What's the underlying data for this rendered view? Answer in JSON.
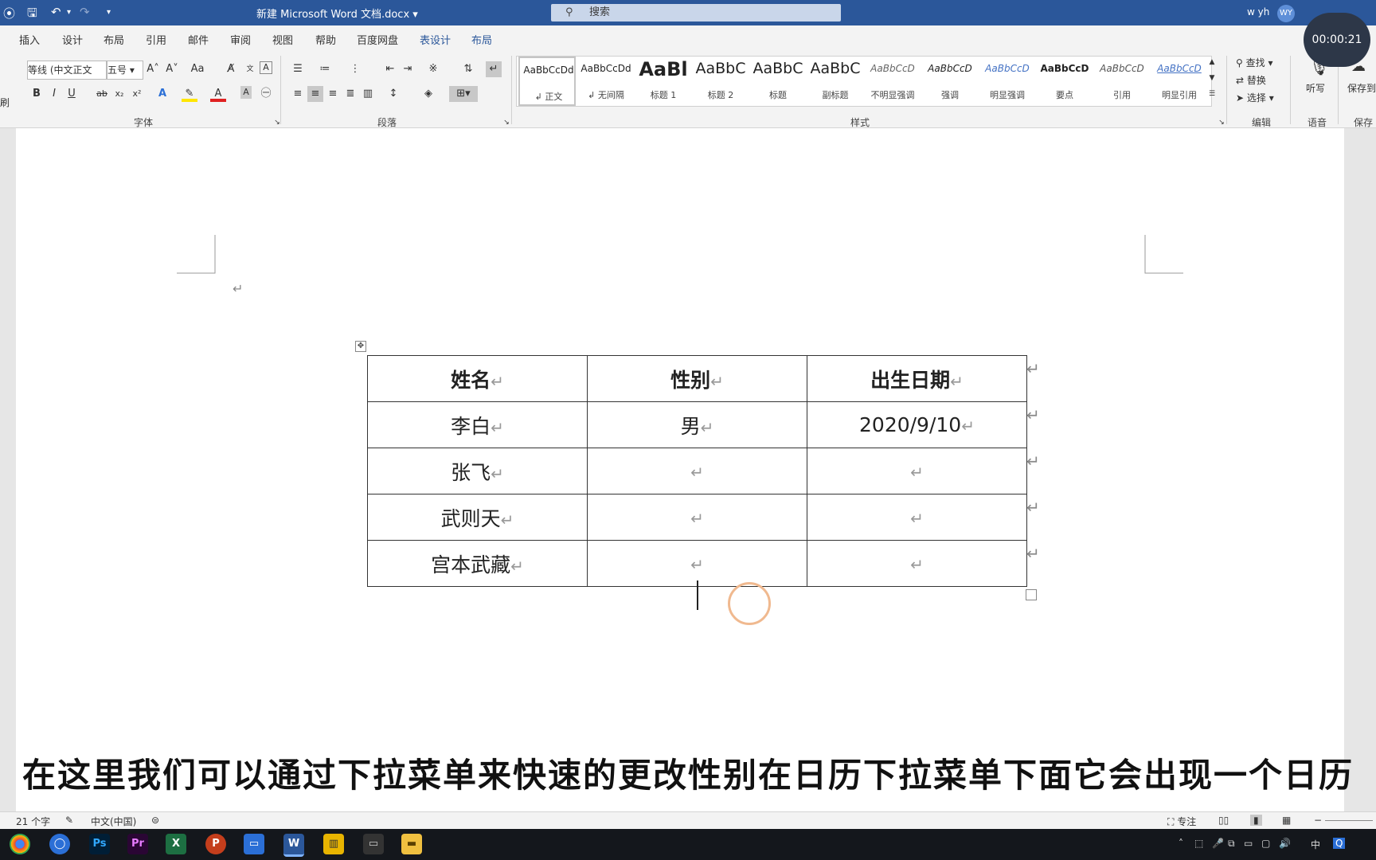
{
  "titlebar": {
    "doc_title": "新建 Microsoft Word 文档.docx",
    "search_placeholder": "搜索",
    "user_name": "w yh",
    "avatar_initials": "WY"
  },
  "ribbon_tabs": [
    "插入",
    "设计",
    "布局",
    "引用",
    "邮件",
    "审阅",
    "视图",
    "帮助",
    "百度网盘",
    "表设计",
    "布局"
  ],
  "font_group": {
    "font_name": "等线 (中文正文",
    "font_size": "五号",
    "label": "字体"
  },
  "paragraph_group": {
    "label": "段落"
  },
  "styles_group": {
    "label": "样式",
    "items": [
      {
        "preview": "AaBbCcDd",
        "name": "↲ 正文"
      },
      {
        "preview": "AaBbCcDd",
        "name": "↲ 无间隔"
      },
      {
        "preview": "AaBl",
        "name": "标题 1"
      },
      {
        "preview": "AaBbC",
        "name": "标题 2"
      },
      {
        "preview": "AaBbC",
        "name": "标题"
      },
      {
        "preview": "AaBbC",
        "name": "副标题"
      },
      {
        "preview": "AaBbCcD",
        "name": "不明显强调"
      },
      {
        "preview": "AaBbCcD",
        "name": "强调"
      },
      {
        "preview": "AaBbCcD",
        "name": "明显强调"
      },
      {
        "preview": "AaBbCcD",
        "name": "要点"
      },
      {
        "preview": "AaBbCcD",
        "name": "引用"
      },
      {
        "preview": "AaBbCcD",
        "name": "明显引用"
      }
    ]
  },
  "editing_group": {
    "find": "查找",
    "replace": "替换",
    "select": "选择",
    "label": "编辑"
  },
  "voice_group": {
    "dictate": "听写",
    "label": "语音"
  },
  "save_group": {
    "baidu": "保存到百度网盘",
    "label": "保存"
  },
  "timer": "00:00:21",
  "table": {
    "headers": [
      "姓名",
      "性别",
      "出生日期"
    ],
    "rows": [
      [
        "李白",
        "男",
        "2020/9/10"
      ],
      [
        "张飞",
        "",
        ""
      ],
      [
        "武则天",
        "",
        ""
      ],
      [
        "宫本武藏",
        "",
        ""
      ]
    ]
  },
  "subtitle": "在这里我们可以通过下拉菜单来快速的更改性别在日历下拉菜单下面它会出现一个日历",
  "statusbar": {
    "word_count": "21 个字",
    "language": "中文(中国)",
    "focus": "专注"
  },
  "taskbar": {
    "apps": [
      "Chrome",
      "Search",
      "Ps",
      "Pr",
      "X",
      "P",
      "Meet",
      "W",
      "Chart",
      "Terminal",
      "Folder"
    ],
    "ime": "中"
  }
}
